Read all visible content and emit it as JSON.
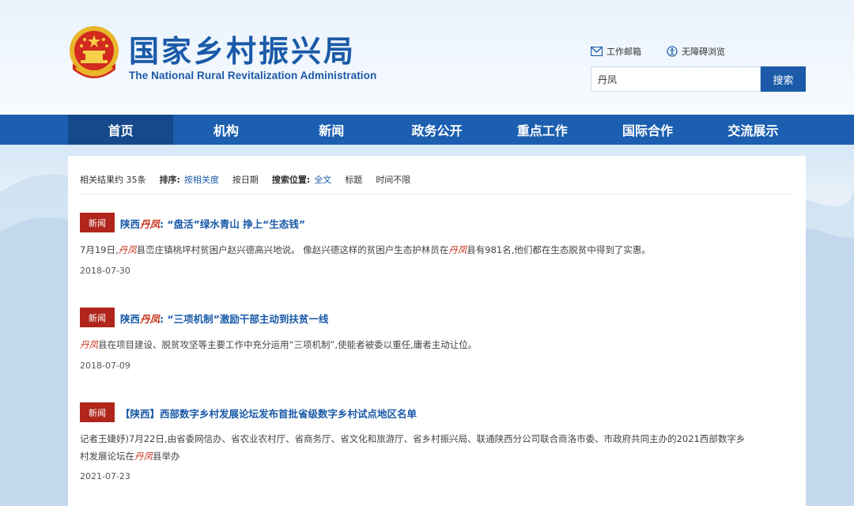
{
  "header": {
    "title_cn": "国家乡村振兴局",
    "title_en": "The National Rural Revitalization Administration",
    "links": [
      {
        "label": "工作邮箱",
        "icon": "mail-icon"
      },
      {
        "label": "无障碍浏览",
        "icon": "accessibility-icon"
      }
    ],
    "search": {
      "value": "丹凤",
      "button": "搜索"
    }
  },
  "nav": {
    "items": [
      "首页",
      "机构",
      "新闻",
      "政务公开",
      "重点工作",
      "国际合作",
      "交流展示"
    ],
    "active_index": 0
  },
  "filter": {
    "count_text": "相关结果约 35条",
    "sort_label": "排序:",
    "sort_options": [
      "按相关度",
      "按日期"
    ],
    "sort_selected": "按相关度",
    "position_label": "搜索位置:",
    "position_options": [
      "全文",
      "标题"
    ],
    "position_selected": "全文",
    "time_option": "时间不限"
  },
  "results": [
    {
      "tag": "新闻",
      "title_pre": "陕西",
      "title_hl": "丹凤",
      "title_post": ": “盘活”绿水青山 挣上“生态钱”",
      "desc_parts": [
        "7月19日,",
        "丹凤",
        "县峦庄镇桃坪村贫困户赵兴德高兴地说。 像赵兴德这样的贫困户生态护林员在",
        "丹凤",
        "县有981名,他们都在生态脱贫中得到了实惠。"
      ],
      "date": "2018-07-30"
    },
    {
      "tag": "新闻",
      "title_pre": "陕西",
      "title_hl": "丹凤",
      "title_post": ": “三项机制”激励干部主动到扶贫一线",
      "desc_parts": [
        "",
        "丹凤",
        "县在项目建设、脱贫攻坚等主要工作中充分运用“三项机制”,使能者被委以重任,庸者主动让位。",
        "",
        ""
      ],
      "date": "2018-07-09"
    },
    {
      "tag": "新闻",
      "title_pre": "【陕西】西部数字乡村发展论坛发布首批省级数字乡村试点地区名单",
      "title_hl": "",
      "title_post": "",
      "desc_line1": "记者王婕妤)7月22日,由省委网信办、省农业农村厅、省商务厅、省文化和旅游厅、省乡村振兴局、联通陕西分公司联合商洛市委、市政府共同主办的2021西部数字乡",
      "desc_line2_parts": [
        "村发展论坛在",
        "丹凤",
        "县举办"
      ],
      "date": "2021-07-23"
    }
  ],
  "colors": {
    "brand_blue": "#1a5aa8",
    "nav_blue": "#1c5fb0",
    "tag_red": "#b0261c",
    "highlight_red": "#c8321e"
  }
}
